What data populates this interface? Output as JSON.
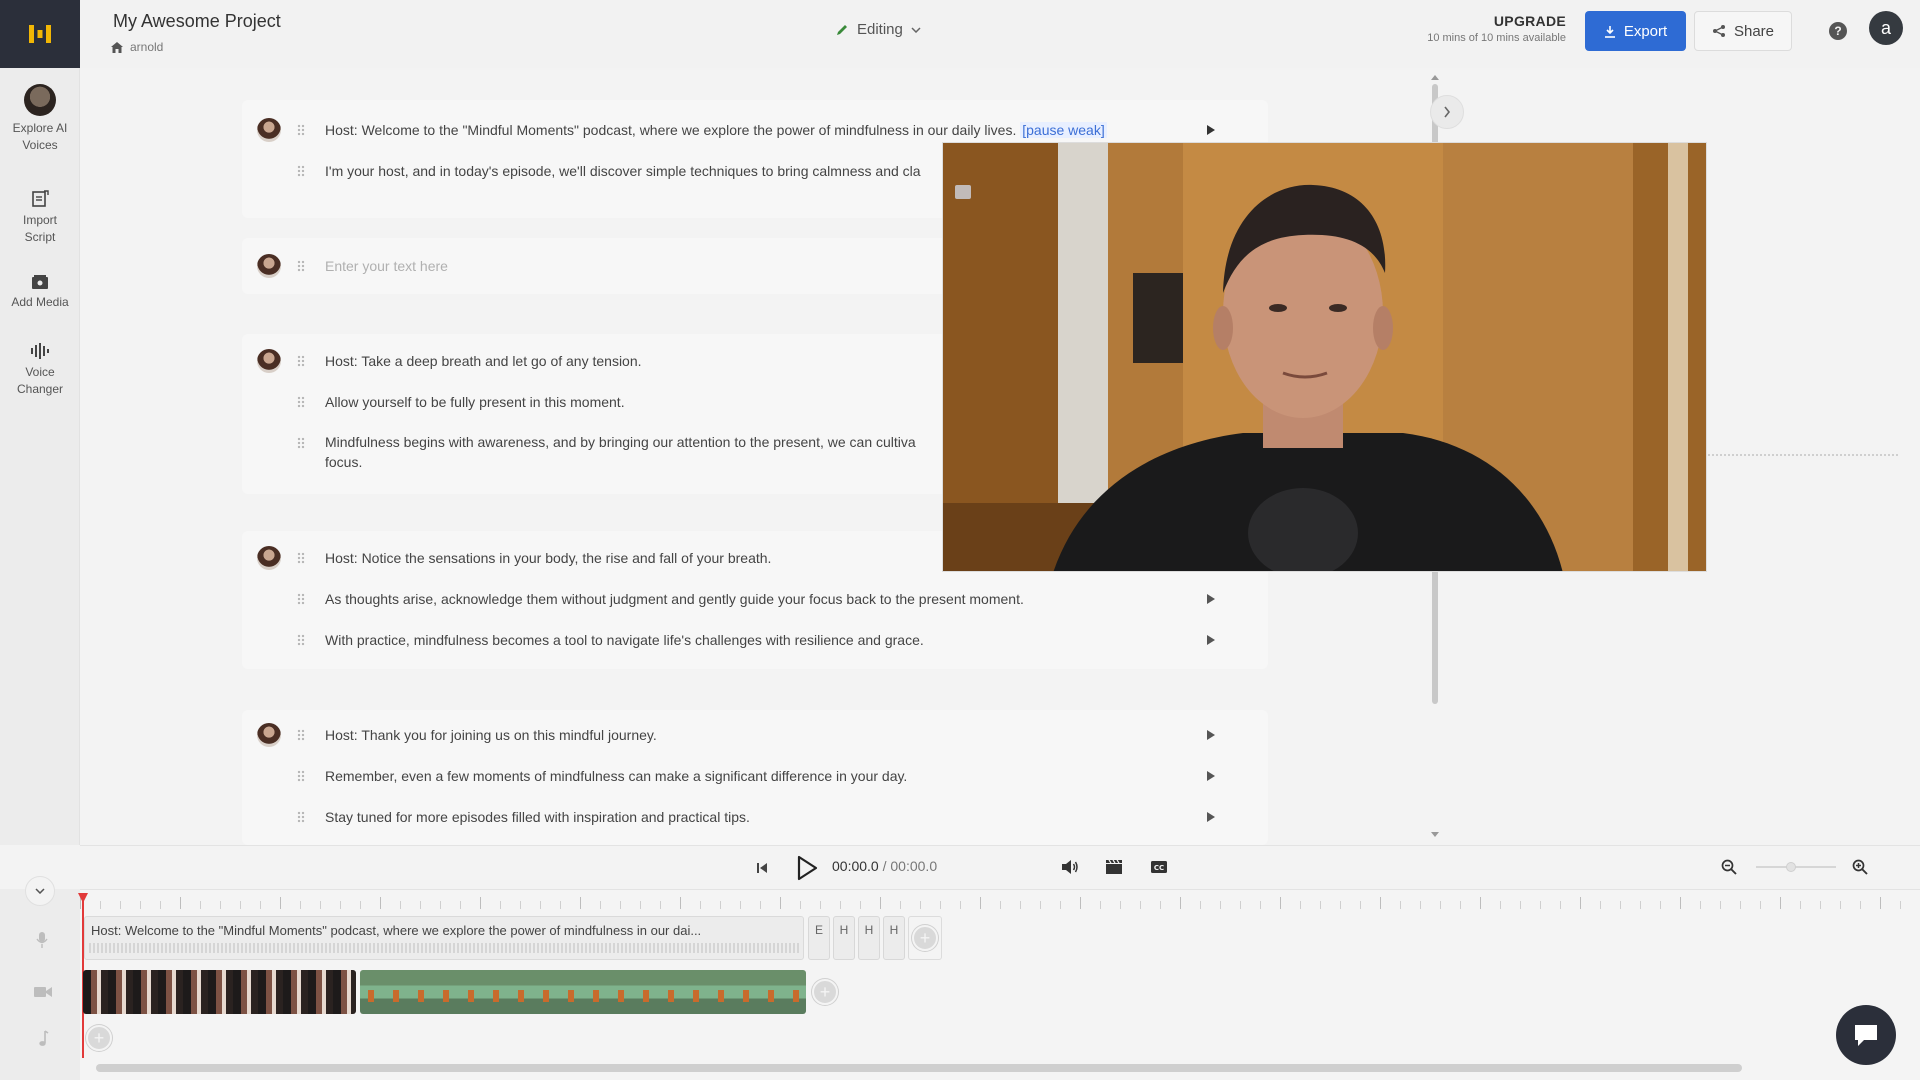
{
  "app": {
    "brand_color": "#2b2f3a",
    "accent": "#2e6bd4"
  },
  "header": {
    "project_title": "My Awesome Project",
    "breadcrumb": "arnold",
    "mode": "Editing",
    "upgrade_label": "UPGRADE",
    "upgrade_sub": "10 mins of 10 mins available",
    "export_label": "Export",
    "share_label": "Share",
    "help_glyph": "?",
    "user_initial": "a"
  },
  "sidebar": {
    "items": [
      {
        "label": "Explore AI Voices",
        "icon": "voice-avatar-icon"
      },
      {
        "label": "Import Script",
        "icon": "import-script-icon"
      },
      {
        "label": "Add Media",
        "icon": "media-icon"
      },
      {
        "label": "Voice Changer",
        "icon": "voice-changer-icon"
      }
    ]
  },
  "script": {
    "paragraphs": [
      {
        "lines": [
          {
            "text": "Host: Welcome to the \"Mindful Moments\" podcast, where we explore the power of mindfulness in our daily lives.",
            "tag": "[pause weak]"
          },
          {
            "text": "I'm your host, and in today's episode, we'll discover simple techniques to bring calmness and cla"
          }
        ]
      },
      {
        "lines": [
          {
            "placeholder": "Enter your text here"
          }
        ]
      },
      {
        "lines": [
          {
            "text": "Host: Take a deep breath and let go of any tension."
          },
          {
            "text": "Allow yourself to be fully present in this moment."
          },
          {
            "text": "Mindfulness begins with awareness, and by bringing our attention to the present, we can cultiva"
          },
          {
            "text": "focus."
          }
        ]
      },
      {
        "lines": [
          {
            "text": "Host: Notice the sensations in your body, the rise and fall of your breath."
          },
          {
            "text": "As thoughts arise, acknowledge them without judgment and gently guide your focus back to the present moment."
          },
          {
            "text": "With practice, mindfulness becomes a tool to navigate life's challenges with resilience and grace."
          }
        ]
      },
      {
        "lines": [
          {
            "text": "Host: Thank you for joining us on this mindful journey."
          },
          {
            "text": "Remember, even a few moments of mindfulness can make a significant difference in your day."
          },
          {
            "text": "Stay tuned for more episodes filled with inspiration and practical tips."
          }
        ]
      }
    ]
  },
  "transport": {
    "current": "00:00.0",
    "separator": " / ",
    "total": "00:00.0"
  },
  "timeline": {
    "audio_clip_text": "Host: Welcome to the \"Mindful Moments\" podcast, where we explore the power of mindfulness in our dai...",
    "mini_clips": [
      "E",
      "H",
      "H",
      "H"
    ]
  }
}
